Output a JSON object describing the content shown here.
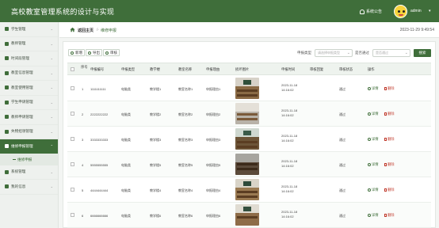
{
  "app": {
    "title": "高校教室管理系统的设计与实现",
    "notice_label": "系统公告",
    "username": "admin",
    "caret": "▾"
  },
  "sidebar": {
    "items": [
      {
        "label": "学生管理"
      },
      {
        "label": "教师管理"
      },
      {
        "label": "时间段管理"
      },
      {
        "label": "教室信息管理"
      },
      {
        "label": "教室使用管理"
      },
      {
        "label": "学生申请管理"
      },
      {
        "label": "教师申请管理"
      },
      {
        "label": "失物招领管理"
      },
      {
        "label": "维修申报管理"
      },
      {
        "label": "系统管理"
      },
      {
        "label": "我的信息"
      }
    ],
    "sub_item": "维修申报"
  },
  "breadcrumb": {
    "home": "返回主页",
    "sep": "/-",
    "current": "维修申报"
  },
  "datetime": "2023-11-29 9:49:54",
  "toolbar": {
    "add": "新增",
    "export": "导出",
    "review": "审核",
    "filter1_label": "申报类型",
    "filter1_placeholder": "请选择申报类型",
    "filter2_label": "是否通过",
    "filter2_placeholder": "是否通过",
    "search": "搜索"
  },
  "table": {
    "headers": [
      "序号",
      "申报编号",
      "申报类型",
      "教学楼",
      "教室名称",
      "申报理由",
      "损坏图片",
      "申报时间",
      "审核回复",
      "审核状态",
      "操作"
    ],
    "rows": [
      {
        "index": "1",
        "code": "1111111111",
        "type": "电脑类",
        "building": "教学楼1",
        "room": "教室名称1",
        "reason": "申报理由1",
        "time": "2023-11-18 14:16:02",
        "reply": "",
        "status": "通过"
      },
      {
        "index": "2",
        "code": "2222222222",
        "type": "电脑类",
        "building": "教学楼2",
        "room": "教室名称2",
        "reason": "申报理由2",
        "time": "2023-11-18 14:16:02",
        "reply": "",
        "status": "通过"
      },
      {
        "index": "3",
        "code": "3333333333",
        "type": "电脑类",
        "building": "教学楼3",
        "room": "教室名称3",
        "reason": "申报理由3",
        "time": "2023-11-18 14:16:02",
        "reply": "",
        "status": "通过"
      },
      {
        "index": "4",
        "code": "5555555555",
        "type": "电脑类",
        "building": "教学楼5",
        "room": "教室名称5",
        "reason": "申报理由5",
        "time": "2023-11-18 14:16:02",
        "reply": "",
        "status": "通过"
      },
      {
        "index": "5",
        "code": "4444444444",
        "type": "电脑类",
        "building": "教学楼4",
        "room": "教室名称4",
        "reason": "申报理由4",
        "time": "2023-11-18 14:16:02",
        "reply": "",
        "status": "通过"
      },
      {
        "index": "6",
        "code": "6666666666",
        "type": "电脑类",
        "building": "教学楼6",
        "room": "教室名称6",
        "reason": "申报理由6",
        "time": "2023-11-18 14:16:02",
        "reply": "",
        "status": "通过"
      }
    ],
    "detail_label": "详情",
    "delete_label": "删除"
  },
  "colors": {
    "primary": "#3f6e3a",
    "danger": "#c0392b"
  }
}
